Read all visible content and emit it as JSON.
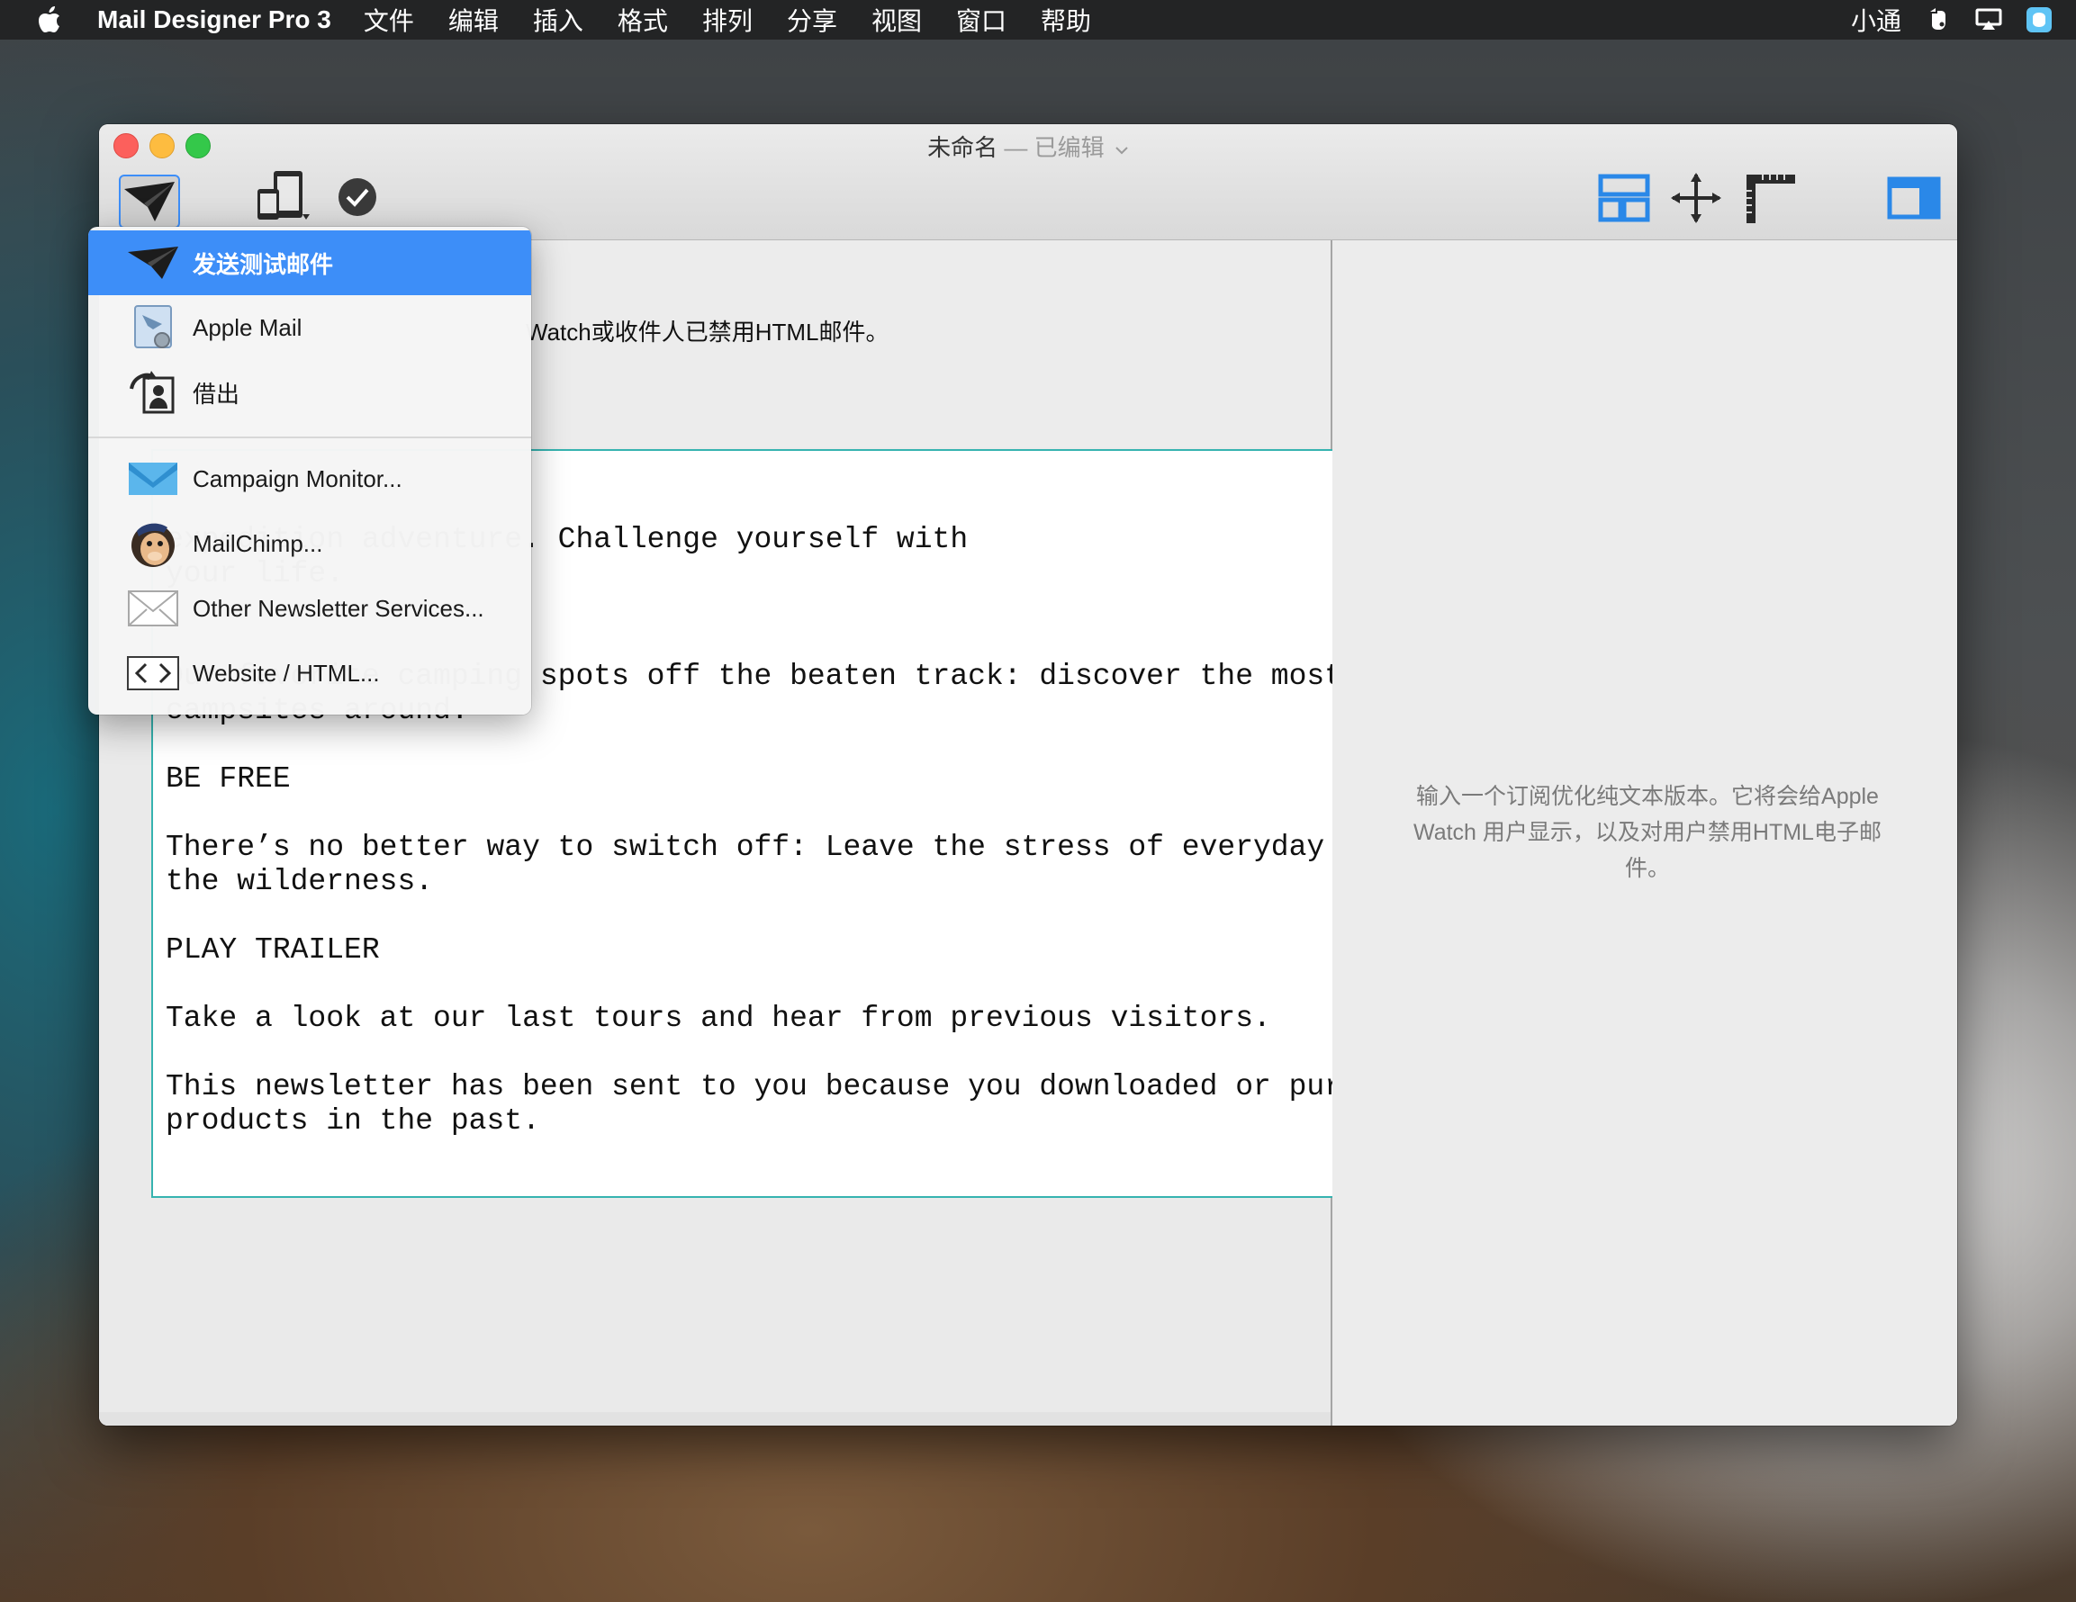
{
  "menubar": {
    "app_name": "Mail Designer Pro 3",
    "items": [
      "文件",
      "编辑",
      "插入",
      "格式",
      "排列",
      "分享",
      "视图",
      "窗口",
      "帮助"
    ],
    "user": "小通",
    "status_icons": [
      "evernote-icon",
      "airplay-icon",
      "finder-icon"
    ]
  },
  "window": {
    "title": "未命名",
    "title_status": "— 已编辑",
    "toolbar_left": [
      "send-icon",
      "devices-icon",
      "check-icon"
    ],
    "toolbar_right": [
      "layout-blocks-icon",
      "move-icon",
      "ruler-icon",
      "sidebar-icon"
    ]
  },
  "editor": {
    "notice_fragment": "Watch或收件人已禁用HTML邮件。",
    "lines": [
      "expedition adventure. Challenge yourself with",
      "your life.",
      "",
      "",
      "Our favorite camping spots off the beaten track: discover the most",
      "campsites around.",
      "",
      "BE FREE",
      "",
      "There’s no better way to switch off: Leave the stress of everyday l",
      "the wilderness.",
      "",
      "PLAY TRAILER",
      "",
      "Take a look at our last tours and hear from previous visitors.",
      "",
      "This newsletter has been sent to you because you downloaded or purc",
      "products in the past."
    ]
  },
  "side_panel": {
    "hint": "输入一个订阅优化纯文本版本。它将会给Apple Watch 用户显示，以及对用户禁用HTML电子邮件。"
  },
  "dropdown": {
    "items": [
      {
        "label": "发送测试邮件",
        "icon": "paper-plane-icon",
        "selected": true
      },
      {
        "label": "Apple Mail",
        "icon": "apple-mail-icon"
      },
      {
        "label": "借出",
        "icon": "export-icon"
      },
      {
        "label": "Campaign Monitor...",
        "icon": "campaign-monitor-icon"
      },
      {
        "label": "MailChimp...",
        "icon": "mailchimp-icon"
      },
      {
        "label": "Other Newsletter Services...",
        "icon": "envelope-icon"
      },
      {
        "label": "Website / HTML...",
        "icon": "code-icon"
      }
    ]
  },
  "colors": {
    "accent": "#3d8ef8",
    "textbox_border": "#36b3b0",
    "toolbar_blue": "#2a88e8"
  }
}
